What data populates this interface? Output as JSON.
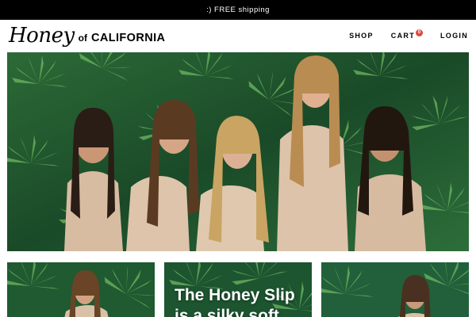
{
  "promo": {
    "text": ":) FREE shipping"
  },
  "brand": {
    "honey": "Honey",
    "of": "of",
    "california": "CALIFORNIA"
  },
  "nav": {
    "shop": "SHOP",
    "cart": "CART",
    "cart_count": "0",
    "login": "LOGIN"
  },
  "hero": {
    "image": "group-of-women-in-nude-slips-tropical-leaf-backdrop"
  },
  "tiles": [
    {
      "image": "woman-in-nude-slip-leaf-backdrop",
      "headline": ""
    },
    {
      "image": "tropical-leaf-backdrop",
      "headline": "The Honey Slip is a silky soft"
    },
    {
      "image": "woman-smiling-leaf-backdrop",
      "headline": ""
    }
  ],
  "colors": {
    "promo_bg": "#000000",
    "badge": "#e0493e",
    "leaf_dark": "#1b4a2a",
    "leaf_light": "#5fae5a"
  }
}
